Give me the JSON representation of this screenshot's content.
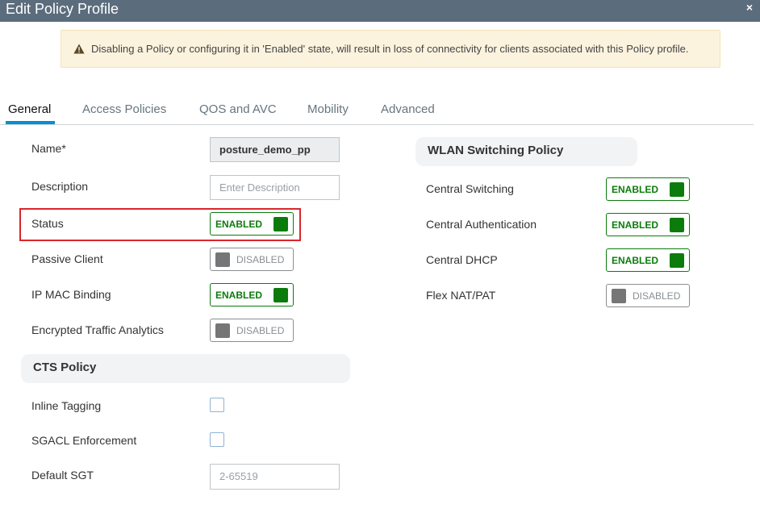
{
  "window": {
    "title": "Edit Policy Profile",
    "close_symbol": "×"
  },
  "warning": {
    "text": "Disabling a Policy or configuring it in 'Enabled' state, will result in loss of connectivity for clients associated with this Policy profile."
  },
  "tabs": [
    {
      "label": "General",
      "active": true
    },
    {
      "label": "Access Policies"
    },
    {
      "label": "QOS and AVC"
    },
    {
      "label": "Mobility"
    },
    {
      "label": "Advanced"
    }
  ],
  "general": {
    "name": {
      "label": "Name*",
      "value": "posture_demo_pp"
    },
    "description": {
      "label": "Description",
      "placeholder": "Enter Description"
    },
    "status": {
      "label": "Status",
      "state": "ENABLED"
    },
    "passive_client": {
      "label": "Passive Client",
      "state": "DISABLED"
    },
    "ip_mac_binding": {
      "label": "IP MAC Binding",
      "state": "ENABLED"
    },
    "encrypted_traffic": {
      "label": "Encrypted Traffic Analytics",
      "state": "DISABLED"
    }
  },
  "cts": {
    "title": "CTS Policy",
    "inline_tagging": {
      "label": "Inline Tagging",
      "checked": false
    },
    "sgacl": {
      "label": "SGACL Enforcement",
      "checked": false
    },
    "default_sgt": {
      "label": "Default SGT",
      "placeholder": "2-65519"
    }
  },
  "wlan": {
    "title": "WLAN Switching Policy",
    "central_switching": {
      "label": "Central Switching",
      "state": "ENABLED"
    },
    "central_auth": {
      "label": "Central Authentication",
      "state": "ENABLED"
    },
    "central_dhcp": {
      "label": "Central DHCP",
      "state": "ENABLED"
    },
    "flex_nat": {
      "label": "Flex NAT/PAT",
      "state": "DISABLED"
    }
  },
  "colors": {
    "header": "#5b6c7d",
    "enabled": "#0b7c0b",
    "disabled": "#767676",
    "tab_accent": "#048fd0",
    "highlight": "#d9262b"
  },
  "icons": {
    "warning": "warning-triangle-icon",
    "close": "close-icon"
  }
}
